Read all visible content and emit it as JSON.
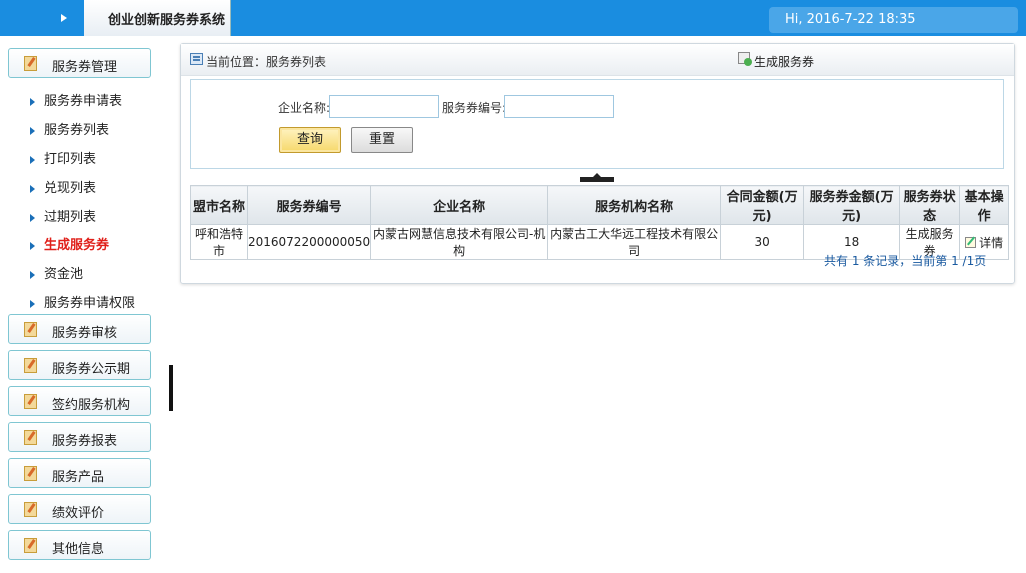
{
  "header": {
    "system_title": "创业创新服务券系统",
    "greeting": "Hi, 2016-7-22 18:35"
  },
  "sidebar": {
    "groups": [
      {
        "label": "服务券管理"
      },
      {
        "label": "服务券审核"
      },
      {
        "label": "服务券公示期"
      },
      {
        "label": "签约服务机构"
      },
      {
        "label": "服务券报表"
      },
      {
        "label": "服务产品"
      },
      {
        "label": "绩效评价"
      },
      {
        "label": "其他信息"
      }
    ],
    "items": [
      {
        "label": "服务券申请表"
      },
      {
        "label": "服务券列表"
      },
      {
        "label": "打印列表"
      },
      {
        "label": "兑现列表"
      },
      {
        "label": "过期列表"
      },
      {
        "label": "生成服务券"
      },
      {
        "label": "资金池"
      },
      {
        "label": "服务券申请权限"
      }
    ],
    "active_item": "生成服务券"
  },
  "main": {
    "breadcrumb": "当前位置：服务券列表",
    "generate_link": "生成服务券",
    "search": {
      "company_label": "企业名称:",
      "company_value": "",
      "code_label": "服务券编号:",
      "code_value": "",
      "query_button": "查询",
      "reset_button": "重置"
    },
    "table": {
      "headers": [
        "盟市名称",
        "服务券编号",
        "企业名称",
        "服务机构名称",
        "合同金额(万元)",
        "服务券金额(万元)",
        "服务券状态",
        "基本操作"
      ],
      "rows": [
        [
          "呼和浩特市",
          "2016072200000050",
          "内蒙古网慧信息技术有限公司-机构",
          "内蒙古工大华远工程技术有限公司",
          "30",
          "18",
          "生成服务券",
          "详情"
        ]
      ]
    },
    "pager": "共有 1 条记录，当前第 1 /1页"
  },
  "colors": {
    "topbar": "#1a8de0",
    "active_menu": "#e0201a",
    "pager_text": "#1a5aa0"
  }
}
